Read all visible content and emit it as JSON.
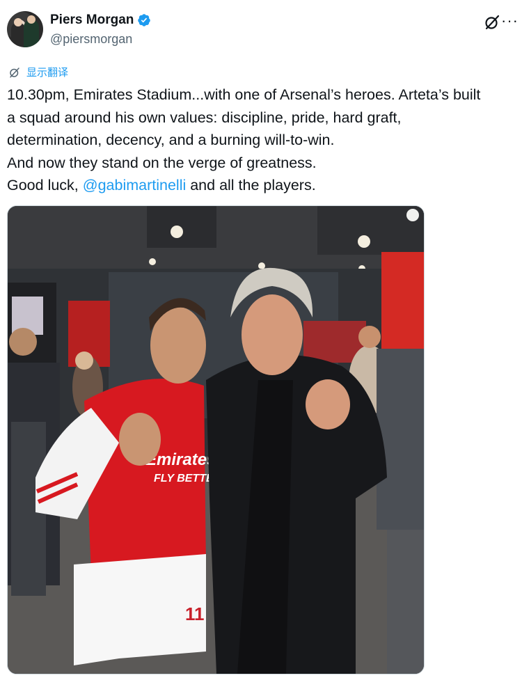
{
  "author": {
    "display_name": "Piers Morgan",
    "handle": "@piersmorgan",
    "verified_icon": "verified-badge-icon",
    "verified_color": "#1d9bf0"
  },
  "header_actions": {
    "grok_icon": "grok-icon",
    "more_icon": "more-icon",
    "more_glyph": "···"
  },
  "translate": {
    "label": "显示翻译",
    "icon": "translate-icon"
  },
  "tweet": {
    "lines": [
      "10.30pm, Emirates Stadium...with one of Arsenal’s heroes. Arteta’s built",
      "a squad around his own values: discipline, pride, hard graft,",
      "determination, decency, and a burning will-to-win.",
      "And now they stand on the verge of greatness."
    ],
    "last_line_prefix": "Good luck, ",
    "mention": "@gabimartinelli",
    "last_line_suffix": " and all the players."
  },
  "media": {
    "description_kind": "photo",
    "shirt_sponsor_line1": "Emirates",
    "shirt_sponsor_line2": "FLY BETTER",
    "shirt_number": "11",
    "colors": {
      "arsenal_red": "#d71920",
      "link_blue": "#1d9bf0"
    }
  }
}
